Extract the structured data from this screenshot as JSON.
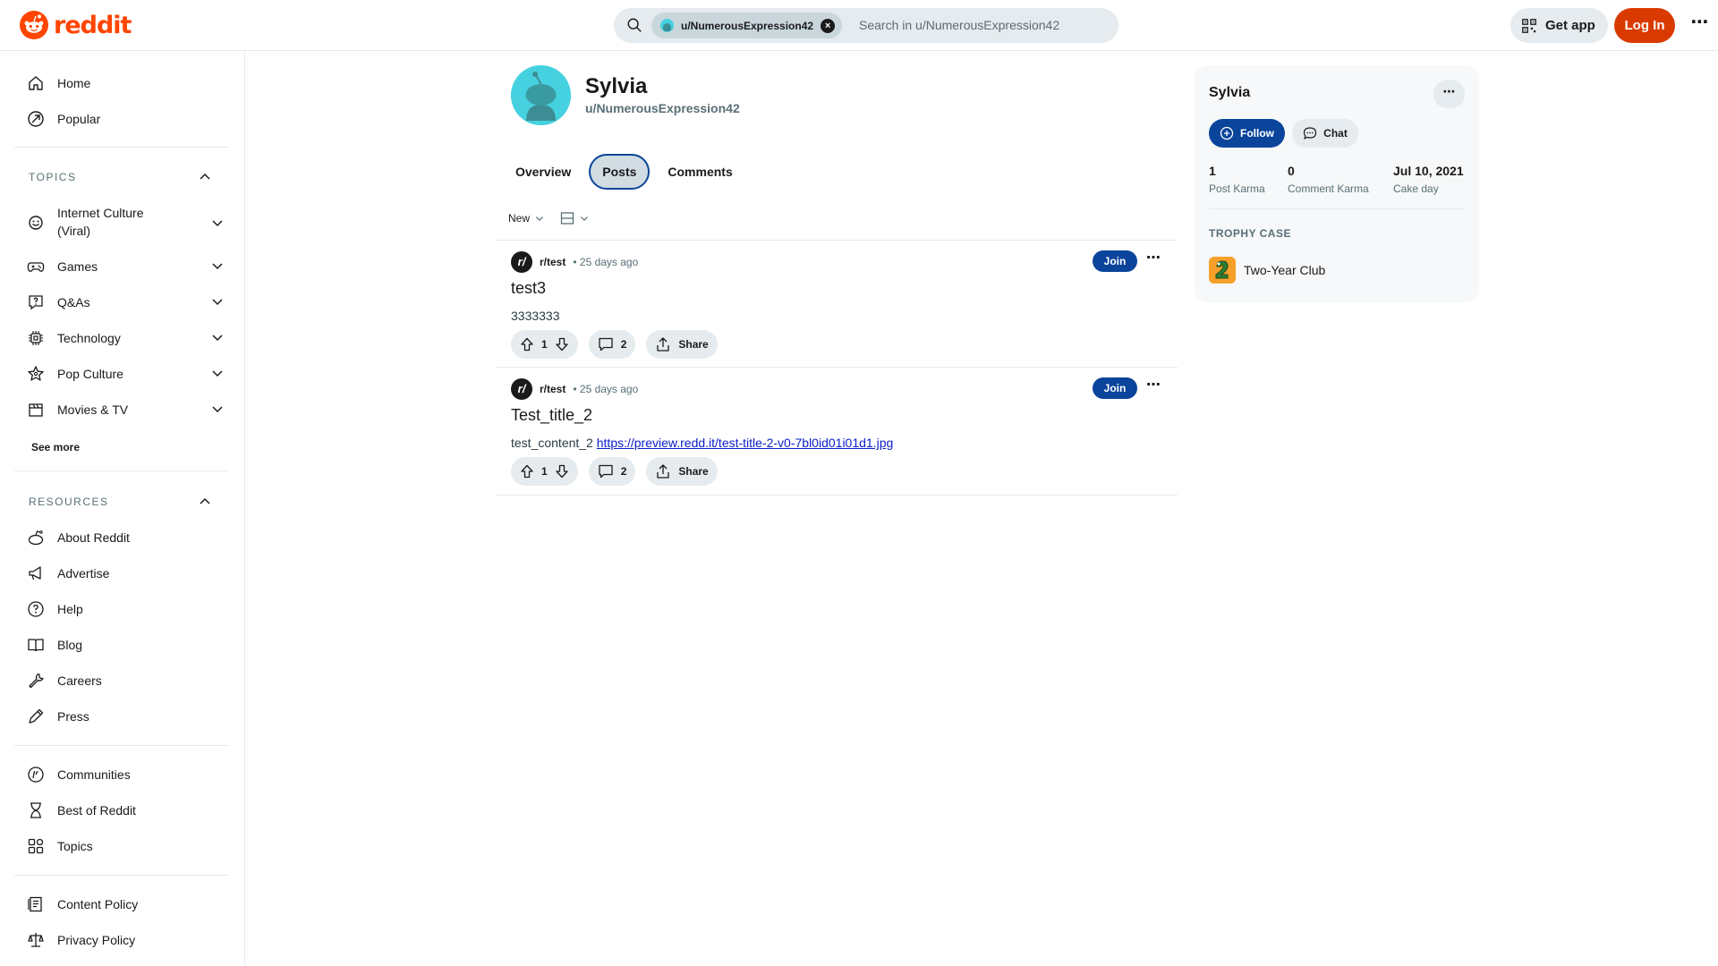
{
  "colors": {
    "brand": "#ff4500",
    "login": "#d93a00",
    "accent": "#0a449b",
    "link": "#0a1cc8"
  },
  "header": {
    "logo_text": "reddit",
    "search_chip": "u/NumerousExpression42",
    "search_placeholder": "Search in u/NumerousExpression42",
    "get_app": "Get app",
    "login": "Log In"
  },
  "sidebar": {
    "top_items": [
      {
        "label": "Home",
        "icon": "home-icon"
      },
      {
        "label": "Popular",
        "icon": "popular-icon"
      }
    ],
    "topics_title": "TOPICS",
    "topics": [
      {
        "label": "Internet Culture (Viral)",
        "icon": "smile-icon"
      },
      {
        "label": "Games",
        "icon": "gamepad-icon"
      },
      {
        "label": "Q&As",
        "icon": "qa-icon"
      },
      {
        "label": "Technology",
        "icon": "chip-icon"
      },
      {
        "label": "Pop Culture",
        "icon": "star-icon"
      },
      {
        "label": "Movies & TV",
        "icon": "clapper-icon"
      }
    ],
    "see_more": "See more",
    "resources_title": "RESOURCES",
    "resources": [
      {
        "label": "About Reddit",
        "icon": "reddit-alien-icon"
      },
      {
        "label": "Advertise",
        "icon": "megaphone-icon"
      },
      {
        "label": "Help",
        "icon": "help-icon"
      },
      {
        "label": "Blog",
        "icon": "book-icon"
      },
      {
        "label": "Careers",
        "icon": "wrench-icon"
      },
      {
        "label": "Press",
        "icon": "pen-icon"
      }
    ],
    "more_items": [
      {
        "label": "Communities",
        "icon": "communities-icon"
      },
      {
        "label": "Best of Reddit",
        "icon": "hourglass-icon"
      },
      {
        "label": "Topics",
        "icon": "topics-grid-icon"
      }
    ],
    "policy_items": [
      {
        "label": "Content Policy",
        "icon": "policy-icon"
      },
      {
        "label": "Privacy Policy",
        "icon": "scales-icon"
      }
    ]
  },
  "profile": {
    "display_name": "Sylvia",
    "username": "u/NumerousExpression42",
    "tabs": [
      "Overview",
      "Posts",
      "Comments"
    ],
    "active_tab": "Posts",
    "sort": "New"
  },
  "posts": [
    {
      "subreddit": "r/test",
      "subreddit_icon": "r/",
      "time": "25 days ago",
      "join": "Join",
      "title": "test3",
      "body": "3333333",
      "link": "",
      "votes": "1",
      "comments": "2",
      "share": "Share"
    },
    {
      "subreddit": "r/test",
      "subreddit_icon": "r/",
      "time": "25 days ago",
      "join": "Join",
      "title": "Test_title_2",
      "body": "test_content_2",
      "link": "https://preview.redd.it/test-title-2-v0-7bl0id01i01d1.jpg",
      "votes": "1",
      "comments": "2",
      "share": "Share"
    }
  ],
  "card": {
    "name": "Sylvia",
    "follow": "Follow",
    "chat": "Chat",
    "stats": [
      {
        "value": "1",
        "label": "Post Karma"
      },
      {
        "value": "0",
        "label": "Comment Karma"
      },
      {
        "value": "Jul 10, 2021",
        "label": "Cake day"
      }
    ],
    "trophy_title": "TROPHY CASE",
    "trophies": [
      {
        "label": "Two-Year Club",
        "icon": "two-year-club-icon"
      }
    ]
  }
}
